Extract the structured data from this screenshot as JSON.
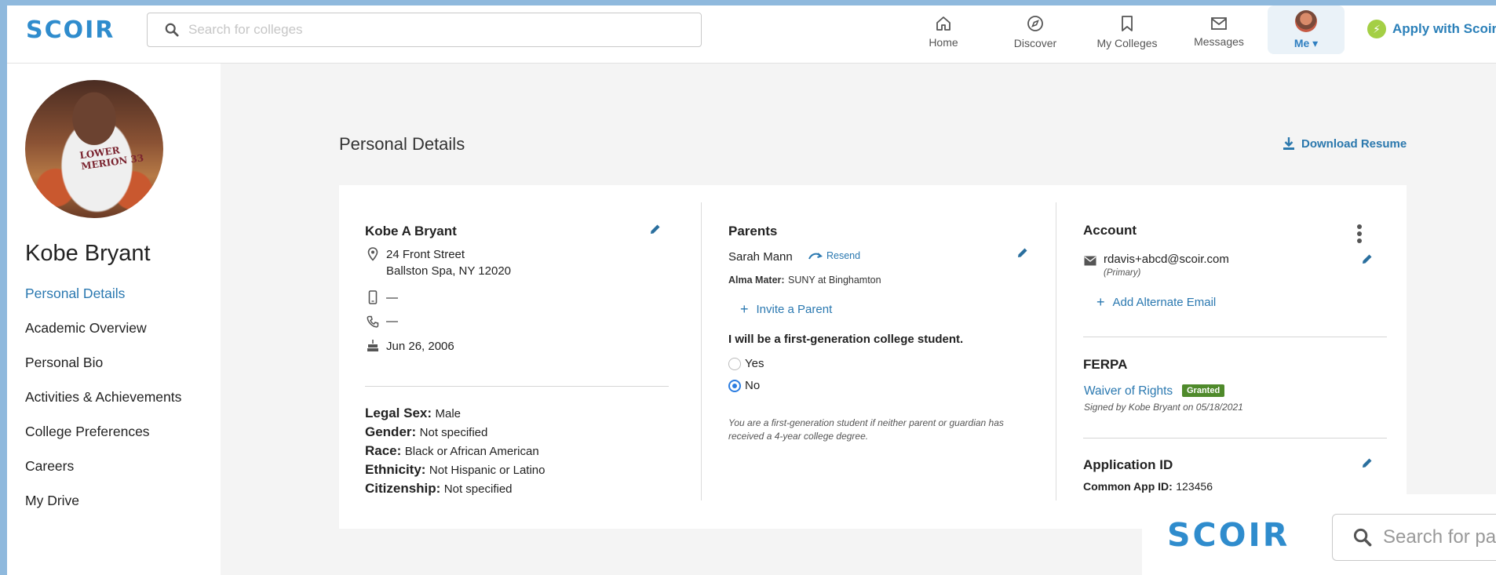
{
  "app": {
    "logo": "SCOIR",
    "search_placeholder": "Search for colleges",
    "apply_label": "Apply with Scoir"
  },
  "nav": [
    {
      "label": "Home",
      "icon": "home-icon"
    },
    {
      "label": "Discover",
      "icon": "compass-icon"
    },
    {
      "label": "My Colleges",
      "icon": "bookmark-icon"
    },
    {
      "label": "Messages",
      "icon": "envelope-icon"
    },
    {
      "label": "Me",
      "icon": "avatar"
    }
  ],
  "sidebar": {
    "name": "Kobe Bryant",
    "photo_text": "LOWER MERION 33",
    "items": [
      {
        "label": "Personal Details",
        "active": true
      },
      {
        "label": "Academic Overview"
      },
      {
        "label": "Personal Bio"
      },
      {
        "label": "Activities & Achievements"
      },
      {
        "label": "College Preferences"
      },
      {
        "label": "Careers"
      },
      {
        "label": "My Drive"
      }
    ]
  },
  "page": {
    "title": "Personal Details",
    "download_label": "Download Resume"
  },
  "student": {
    "full_name": "Kobe A Bryant",
    "address_line1": "24 Front Street",
    "address_line2": "Ballston Spa, NY 12020",
    "mobile": "—",
    "phone": "—",
    "birthday": "Jun 26, 2006",
    "legal_sex_label": "Legal Sex:",
    "legal_sex": "Male",
    "gender_label": "Gender:",
    "gender": "Not specified",
    "race_label": "Race:",
    "race": "Black or African American",
    "ethnicity_label": "Ethnicity:",
    "ethnicity": "Not Hispanic or Latino",
    "citizenship_label": "Citizenship:",
    "citizenship": "Not specified"
  },
  "parents": {
    "heading": "Parents",
    "parent_name": "Sarah Mann",
    "resend_label": "Resend",
    "alma_mater_label": "Alma Mater:",
    "alma_mater": "SUNY at Binghamton",
    "invite_label": "Invite a Parent",
    "first_gen_question": "I will be a first-generation college student.",
    "options": [
      {
        "label": "Yes",
        "checked": false
      },
      {
        "label": "No",
        "checked": true
      }
    ],
    "first_gen_note_line1": "You are a first-generation student if neither parent or guardian has",
    "first_gen_note_line2": "received a 4-year college degree."
  },
  "account": {
    "heading": "Account",
    "email": "rdavis+abcd@scoir.com",
    "email_tag": "(Primary)",
    "add_email_label": "Add Alternate Email",
    "ferpa_heading": "FERPA",
    "waiver_label": "Waiver of Rights",
    "waiver_status": "Granted",
    "signed_note": "Signed by Kobe Bryant on 05/18/2021",
    "app_id_heading": "Application ID",
    "common_app_label": "Common App ID:",
    "common_app_id": "123456"
  },
  "overlay": {
    "logo": "SCOIR",
    "search_text": "Search for pa"
  },
  "colors": {
    "brand_blue": "#2f8ccd",
    "link_blue": "#2a78b0",
    "granted_green": "#4f8a2b",
    "apply_bolt": "#a4cf45"
  }
}
